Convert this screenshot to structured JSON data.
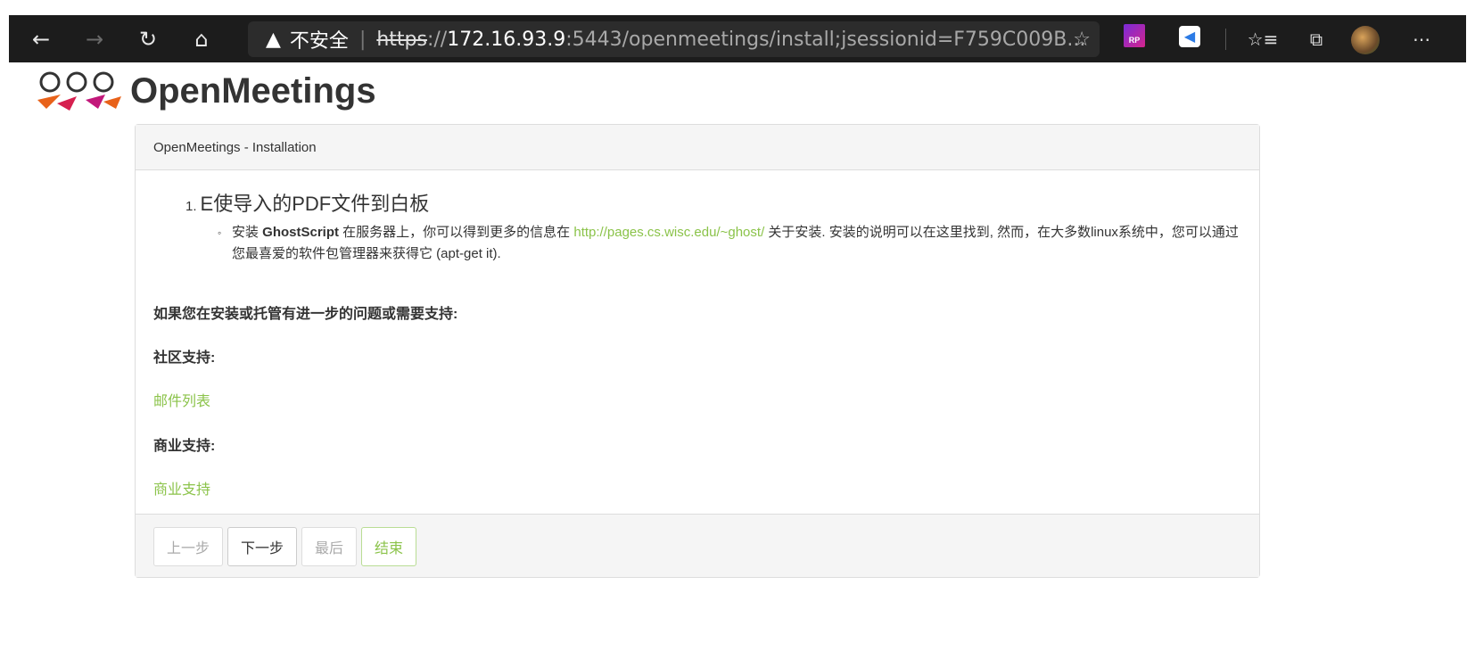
{
  "browser": {
    "warning_symbol": "▲",
    "insecure_label": "不安全",
    "separator": "|",
    "url_scheme": "https",
    "url_scheme_sep": "://",
    "url_host": "172.16.93.9",
    "url_rest": ":5443/openmeetings/install;jsessionid=F759C009B...",
    "icons": [
      "back-icon",
      "forward-icon",
      "refresh-icon",
      "home-icon",
      "favorite-star-icon",
      "rp-extension-icon",
      "k-extension-icon",
      "favorites-list-icon",
      "collections-icon",
      "profile-avatar",
      "more-menu-icon"
    ],
    "ext_rp_label": "RP"
  },
  "app": {
    "title": "OpenMeetings"
  },
  "panel": {
    "heading": "OpenMeetings - Installation",
    "step_number": "1.",
    "step_title": "E使导入的PDF文件到白板",
    "sub_prefix": "安装 ",
    "sub_bold": "GhostScript",
    "sub_mid": " 在服务器上，你可以得到更多的信息在 ",
    "sub_link": "http://pages.cs.wisc.edu/~ghost/",
    "sub_suffix": " 关于安装. 安装的说明可以在这里找到, 然而，在大多数linux系统中，您可以通过您最喜爱的软件包管理器来获得它 (apt-get it).",
    "support_question": "如果您在安装或托管有进一步的问题或需要支持:",
    "community_heading": "社区支持:",
    "community_link": "邮件列表",
    "commercial_heading": "商业支持:",
    "commercial_link": "商业支持"
  },
  "footer": {
    "prev_label": "上一步",
    "next_label": "下一步",
    "last_label": "最后",
    "finish_label": "结束"
  },
  "colors": {
    "link": "#8bc34a",
    "toolbar_bg": "#1c1c1c",
    "panel_heading_bg": "#f5f5f5"
  }
}
